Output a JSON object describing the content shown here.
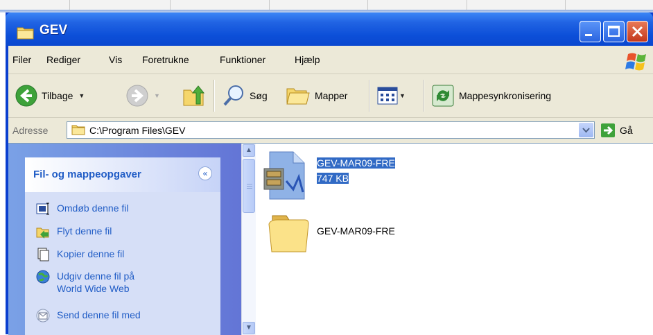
{
  "window": {
    "title": "GEV"
  },
  "menu": [
    "Filer",
    "Rediger",
    "Vis",
    "Foretrukne",
    "Funktioner",
    "Hjælp"
  ],
  "toolbar": {
    "back": "Tilbage",
    "search": "Søg",
    "folders": "Mapper",
    "sync": "Mappesynkronisering"
  },
  "address": {
    "label": "Adresse",
    "path": "C:\\Program Files\\GEV",
    "go": "Gå"
  },
  "taskpane": {
    "title": "Fil- og mappeopgaver",
    "links": [
      {
        "label": "Omdøb denne fil",
        "icon": "rename-icon"
      },
      {
        "label": "Flyt denne fil",
        "icon": "move-icon"
      },
      {
        "label": "Kopier denne fil",
        "icon": "copy-icon"
      },
      {
        "label": "Udgiv denne fil på World Wide Web",
        "line1": "Udgiv denne fil på",
        "line2": "World Wide Web",
        "icon": "publish-icon"
      },
      {
        "label": "Send denne fil med",
        "icon": "email-icon"
      }
    ]
  },
  "files": [
    {
      "name": "GEV-MAR09-FRE",
      "size": "747 KB",
      "type": "zip",
      "selected": true
    },
    {
      "name": "GEV-MAR09-FRE",
      "type": "folder",
      "selected": false
    }
  ]
}
